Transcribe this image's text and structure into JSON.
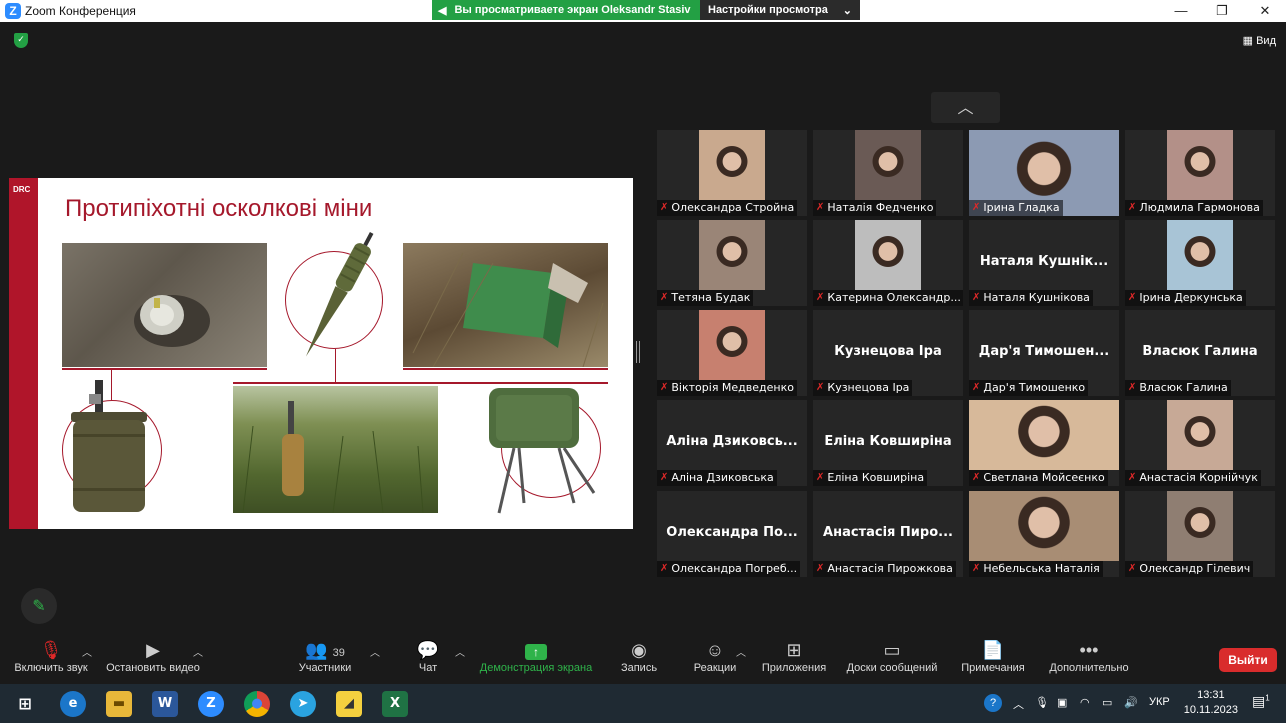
{
  "window": {
    "title": "Zoom Конференция",
    "logo_letter": "Z",
    "minimize": "—",
    "maximize": "❐",
    "close": "✕"
  },
  "share_banner": {
    "viewing_text": "Вы просматриваете экран Oleksandr Stasiv",
    "view_options": "Настройки просмотра"
  },
  "view_button": "Вид",
  "slide": {
    "logo": "DRC",
    "title": "Протипіхотні осколкові міни"
  },
  "participants": [
    {
      "name": "Олександра Стройна",
      "display": "",
      "video": true,
      "bg": "#c9a98e"
    },
    {
      "name": "Наталія Федченко",
      "display": "",
      "video": true,
      "bg": "#6a5a55"
    },
    {
      "name": "Ірина Гладка",
      "display": "",
      "video": true,
      "bg": "#8c9ab3"
    },
    {
      "name": "Людмила Гармонова",
      "display": "",
      "video": true,
      "bg": "#b39088"
    },
    {
      "name": "Тетяна Будак",
      "display": "",
      "video": true,
      "bg": "#9a8577"
    },
    {
      "name": "Катерина Олександр...",
      "display": "",
      "video": true,
      "bg": "#bdbdbd"
    },
    {
      "name": "Наталя Кушнікова",
      "display": "Наталя  Кушнік...",
      "video": false
    },
    {
      "name": "Ірина Деркунська",
      "display": "",
      "video": true,
      "bg": "#a8c4d6"
    },
    {
      "name": "Вікторія Медведенко",
      "display": "",
      "video": true,
      "bg": "#c7806f"
    },
    {
      "name": "Кузнецова Іра",
      "display": "Кузнецова Іра",
      "video": false
    },
    {
      "name": "Дар'я Тимошенко",
      "display": "Дар'я  Тимошен...",
      "video": false
    },
    {
      "name": "Власюк Галина",
      "display": "Власюк Галина",
      "video": false
    },
    {
      "name": "Аліна Дзиковська",
      "display": "Аліна  Дзиковсь...",
      "video": false
    },
    {
      "name": "Еліна Ковширіна",
      "display": "Еліна Ковширіна",
      "video": false
    },
    {
      "name": "Светлана Мойсеєнко",
      "display": "",
      "video": true,
      "bg": "#d7b99a"
    },
    {
      "name": "Анастасія Корнійчук",
      "display": "",
      "video": true,
      "bg": "#c7a996"
    },
    {
      "name": "Олександра Погреб...",
      "display": "Олександра  По...",
      "video": false
    },
    {
      "name": "Анастасія Пирожкова",
      "display": "Анастасія  Пиро...",
      "video": false
    },
    {
      "name": "Небельська Наталія",
      "display": "",
      "video": true,
      "bg": "#a88d74"
    },
    {
      "name": "Олександр Гілевич",
      "display": "",
      "video": true,
      "bg": "#8f7e72"
    }
  ],
  "toolbar": {
    "unmute": "Включить звук",
    "start_video": "Остановить видео",
    "participants": "Участники",
    "participants_count": "39",
    "chat": "Чат",
    "share": "Демонстрация экрана",
    "record": "Запись",
    "reactions": "Реакции",
    "apps": "Приложения",
    "whiteboards": "Доски сообщений",
    "notes": "Примечания",
    "more": "Дополнительно",
    "leave": "Выйти"
  },
  "taskbar": {
    "language": "УКР",
    "time": "13:31",
    "date": "10.11.2023",
    "notifications": "1"
  },
  "colors": {
    "zoom_blue": "#2d8cff",
    "share_green": "#23a044",
    "leave_red": "#d92c2c",
    "slide_red": "#a5182b"
  }
}
